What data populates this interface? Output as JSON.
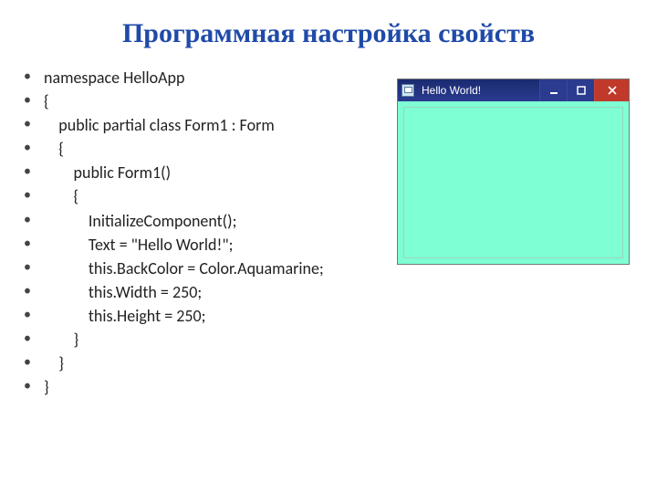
{
  "title": "Программная настройка свойств",
  "code_lines": [
    "namespace HelloApp",
    "{",
    "    public partial class Form1 : Form",
    "    {",
    "        public Form1()",
    "        {",
    "            InitializeComponent();",
    "            Text = \"Hello World!\";",
    "            this.BackColor = Color.Aquamarine;",
    "            this.Width = 250;",
    "            this.Height = 250;",
    "        }",
    "    }",
    "}"
  ],
  "window": {
    "title": "Hello World!",
    "back_color": "#7fffd4",
    "controls": {
      "minimize": "minimize",
      "maximize": "maximize",
      "close": "close"
    }
  }
}
